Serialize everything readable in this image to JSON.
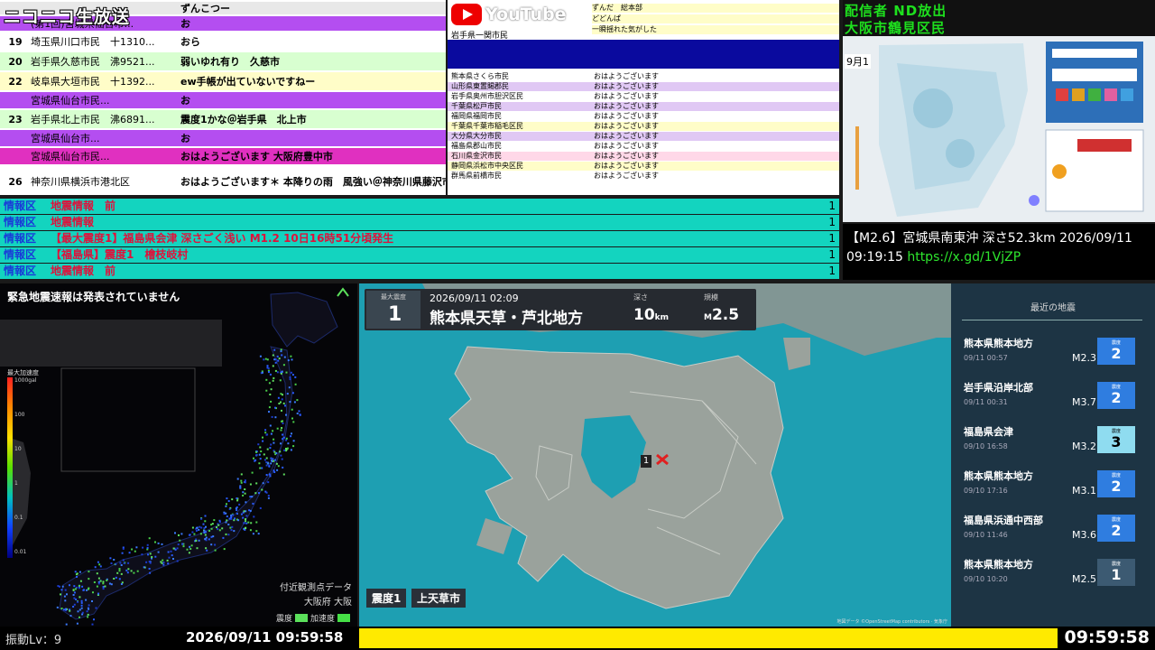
{
  "brand": "ニコニコ生放送",
  "comments": [
    {
      "num": "",
      "name": "",
      "msg": "ずんこつー",
      "bg": "#e8e8e8"
    },
    {
      "num": "",
      "name": "(第1回)宮城県仙台市...",
      "msg": "お",
      "bg": "#b44ef0"
    },
    {
      "num": "19",
      "name": "埼玉県川口市民　十1310...",
      "msg": "おら",
      "bg": "#ffffff"
    },
    {
      "num": "20",
      "name": "岩手県久慈市民　沸9521...",
      "msg": "弱いゆれ有り　久慈市",
      "bg": "#d8ffd0"
    },
    {
      "num": "22",
      "name": "岐阜県大垣市民　十1392...",
      "msg": "ew手帳が出ていないですねー",
      "bg": "#fffdc8"
    },
    {
      "num": "",
      "name": "宮城県仙台市民...",
      "msg": "お",
      "bg": "#b44ef0"
    },
    {
      "num": "23",
      "name": "岩手県北上市民　沸6891...",
      "msg": "震度1かな＠岩手県　北上市",
      "bg": "#d8ffd0"
    },
    {
      "num": "",
      "name": "宮城県仙台市...",
      "msg": "お",
      "bg": "#b44ef0"
    },
    {
      "num": "",
      "name": "宮城県仙台市民...",
      "msg": "おはようございます 大阪府豊中市",
      "bg": "#e030c0"
    },
    {
      "num": "26",
      "name": "神奈川県横浜市港北区",
      "msg": "おはようございます＊ 本降りの雨　風強い＠神奈川県藤沢市",
      "bg": "#ffffff"
    }
  ],
  "youtube": {
    "word": "YouTube",
    "rows_top": [
      {
        "name": "",
        "msg": "ずんだ　総本部",
        "bg": "#fffdc8"
      },
      {
        "name": "",
        "msg": "どどんぱ",
        "bg": "#fffdc8"
      },
      {
        "name": "岩手県一関市民",
        "msg": "一瞬揺れた気がした",
        "bg": "#fffdc8"
      }
    ],
    "rows": [
      {
        "name": "熊本県さくら市民",
        "msg": "おはようございます",
        "bg": "#ffffff"
      },
      {
        "name": "山形県東置賜郡民",
        "msg": "おはようございます",
        "bg": "#e0c8f4"
      },
      {
        "name": "岩手県奥州市胆沢区民",
        "msg": "おはようございます",
        "bg": "#ffffff"
      },
      {
        "name": "千葉県松戸市民",
        "msg": "おはようございます",
        "bg": "#e0c8f4"
      },
      {
        "name": "福岡県福岡市民",
        "msg": "おはようございます",
        "bg": "#ffffff"
      },
      {
        "name": "千葉県千葉市稲毛区民",
        "msg": "おはようございます",
        "bg": "#fffdc8"
      },
      {
        "name": "大分県大分市民",
        "msg": "おはようございます",
        "bg": "#e0c8f4"
      },
      {
        "name": "福島県郡山市民",
        "msg": "おはようございます",
        "bg": "#ffffff"
      },
      {
        "name": "石川県金沢市民",
        "msg": "おはようございます",
        "bg": "#ffd8e8"
      },
      {
        "name": "静岡県浜松市中央区民",
        "msg": "おはようございます",
        "bg": "#fffdc8"
      },
      {
        "name": "群馬県前橋市民",
        "msg": "おはようございます",
        "bg": "#ffffff"
      }
    ]
  },
  "streamer": {
    "line1": "配信者 ND放出",
    "line2": "大阪市鶴見区民"
  },
  "small_map": {
    "date": "9月1"
  },
  "eq_info": {
    "text": "【M2.6】宮城県南東沖 深さ52.3km 2026/09/11 09:19:15 ",
    "url": "https://x.gd/1VjZP"
  },
  "info_bars": [
    {
      "label": "情報区",
      "text": "地震情報　前",
      "count": "1"
    },
    {
      "label": "情報区",
      "text": "地震情報",
      "count": "1"
    },
    {
      "label": "情報区",
      "text": "【最大震度1】福島県会津 深さごく浅い M1.2 10日16時51分頃発生",
      "count": "1"
    },
    {
      "label": "情報区",
      "text": "【福島県】震度1　檜枝岐村",
      "count": "1"
    },
    {
      "label": "情報区",
      "text": "地震情報　前",
      "count": "1"
    }
  ],
  "japan_panel": {
    "eew_status": "緊急地震速報は発表されていません",
    "legend_title": "最大加速度",
    "legend_ticks": [
      "1000gal",
      "100",
      "10",
      "1",
      "0.1",
      "0.01"
    ],
    "obs_label1": "付近観測点データ",
    "obs_label2": "大阪府 大阪",
    "obs_legend_a": "震度",
    "obs_legend_b": "加速度",
    "color_a": "#5be05b",
    "color_b": "#46e046"
  },
  "quake": {
    "int_label": "最大震度",
    "intensity": "1",
    "time": "2026/09/11 02:09",
    "place": "熊本県天草・芦北地方",
    "depth_label": "深さ",
    "depth": "10",
    "depth_unit": "km",
    "mag_label": "規模",
    "mag_prefix": "M",
    "magnitude": "2.5",
    "int_tag": "震度1",
    "city_tag": "上天草市",
    "epi_marker": "1",
    "copyright": "地図データ ©OpenStreetMap contributors · 気象庁"
  },
  "recent": {
    "title": "最近の地震",
    "items": [
      {
        "place": "熊本県熊本地方",
        "time": "09/11 00:57",
        "mag": "M2.3",
        "int_label": "震度",
        "intensity": "2",
        "color": "#2f7de0",
        "text_color": "#ffffff"
      },
      {
        "place": "岩手県沿岸北部",
        "time": "09/11 00:31",
        "mag": "M3.7",
        "int_label": "震度",
        "intensity": "2",
        "color": "#2f7de0",
        "text_color": "#ffffff"
      },
      {
        "place": "福島県会津",
        "time": "09/10 16:58",
        "mag": "M3.2",
        "int_label": "震度",
        "intensity": "3",
        "color": "#8fdcf0",
        "text_color": "#000000"
      },
      {
        "place": "熊本県熊本地方",
        "time": "09/10 17:16",
        "mag": "M3.1",
        "int_label": "震度",
        "intensity": "2",
        "color": "#2f7de0",
        "text_color": "#ffffff"
      },
      {
        "place": "福島県浜通中西部",
        "time": "09/10 11:46",
        "mag": "M3.6",
        "int_label": "震度",
        "intensity": "2",
        "color": "#2f7de0",
        "text_color": "#ffffff"
      },
      {
        "place": "熊本県熊本地方",
        "time": "09/10 10:20",
        "mag": "M2.5",
        "int_label": "震度",
        "intensity": "1",
        "color": "#3c5a72",
        "text_color": "#ffffff"
      }
    ]
  },
  "bottom": {
    "vlevel": "振動Lv：9",
    "clock_left": "2026/09/11 09:59:58",
    "clock_right": "09:59:58"
  }
}
